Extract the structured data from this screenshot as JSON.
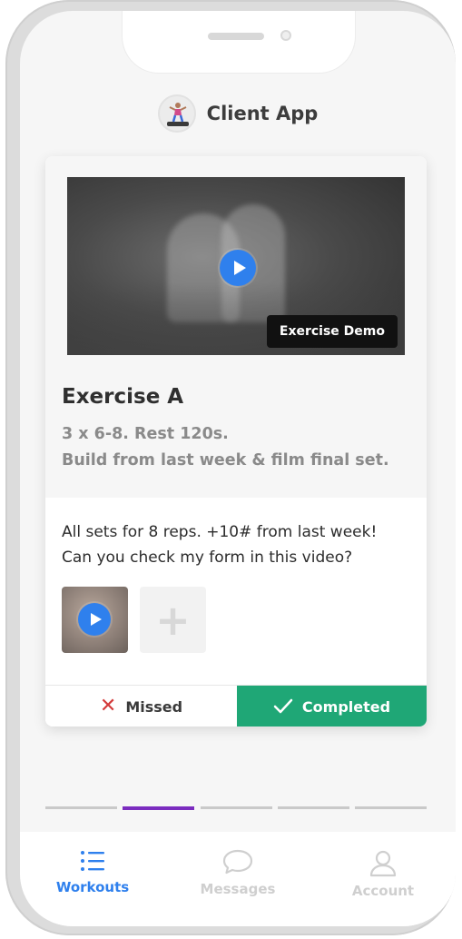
{
  "app": {
    "title": "Client App"
  },
  "exercise": {
    "video_label": "Exercise Demo",
    "name": "Exercise A",
    "prescription": "3 x 6-8. Rest 120s.",
    "instructions": "Build from last week & film final set."
  },
  "client_note": {
    "line1": "All sets for 8 reps. +10# from last week!",
    "line2": "Can you check my form in this video?"
  },
  "actions": {
    "missed_label": "Missed",
    "completed_label": "Completed"
  },
  "progress": {
    "total_steps": 5,
    "active_step": 2
  },
  "tabs": [
    {
      "label": "Workouts",
      "icon": "list-icon",
      "active": true
    },
    {
      "label": "Messages",
      "icon": "chat-bubble-icon",
      "active": false
    },
    {
      "label": "Account",
      "icon": "user-icon",
      "active": false
    }
  ],
  "colors": {
    "accent_blue": "#2f80ed",
    "completed_green": "#1fa776",
    "missed_red": "#d33a3a",
    "progress_active": "#7b2cbf"
  }
}
